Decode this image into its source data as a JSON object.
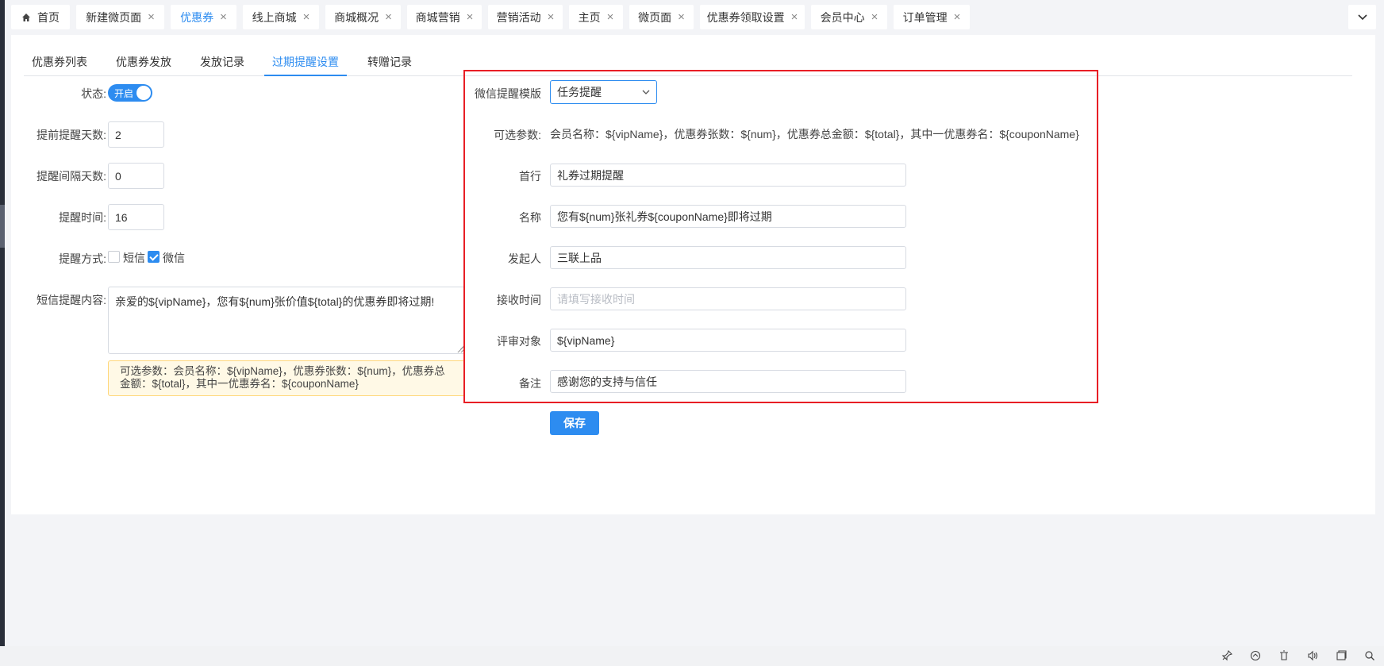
{
  "tabs": [
    {
      "label": "首页",
      "closable": false,
      "active": false
    },
    {
      "label": "新建微页面",
      "closable": true,
      "active": false
    },
    {
      "label": "优惠券",
      "closable": true,
      "active": true
    },
    {
      "label": "线上商城",
      "closable": true,
      "active": false
    },
    {
      "label": "商城概况",
      "closable": true,
      "active": false
    },
    {
      "label": "商城营销",
      "closable": true,
      "active": false
    },
    {
      "label": "营销活动",
      "closable": true,
      "active": false
    },
    {
      "label": "主页",
      "closable": true,
      "active": false
    },
    {
      "label": "微页面",
      "closable": true,
      "active": false
    },
    {
      "label": "优惠券领取设置",
      "closable": true,
      "active": false
    },
    {
      "label": "会员中心",
      "closable": true,
      "active": false
    },
    {
      "label": "订单管理",
      "closable": true,
      "active": false
    }
  ],
  "subtabs": [
    "优惠券列表",
    "优惠券发放",
    "发放记录",
    "过期提醒设置",
    "转赠记录"
  ],
  "active_subtab": "过期提醒设置",
  "form": {
    "status_label": "状态:",
    "status_text": "开启",
    "advance_days_label": "提前提醒天数:",
    "advance_days": "2",
    "interval_days_label": "提醒间隔天数:",
    "interval_days": "0",
    "time_label": "提醒时间:",
    "time": "16",
    "method_label": "提醒方式:",
    "method_sms": "短信",
    "method_sms_checked": false,
    "method_wechat": "微信",
    "method_wechat_checked": true,
    "sms_content_label": "短信提醒内容:",
    "sms_content": "亲爱的${vipName}，您有${num}张价值${total}的优惠券即将过期!",
    "sms_tip": "可选参数：会员名称：${vipName}，优惠券张数：${num}，优惠券总金额：${total}，其中一优惠券名：${couponName}"
  },
  "wechat": {
    "template_label": "微信提醒模版",
    "template_value": "任务提醒",
    "params_label": "可选参数:",
    "params_text": "会员名称：${vipName}，优惠券张数：${num}，优惠券总金额：${total}，其中一优惠券名：${couponName}",
    "first_label": "首行",
    "first_value": "礼券过期提醒",
    "name_label": "名称",
    "name_value": "您有${num}张礼券${couponName}即将过期",
    "sender_label": "发起人",
    "sender_value": "三联上品",
    "receive_label": "接收时间",
    "receive_placeholder": "请填写接收时间",
    "target_label": "评审对象",
    "target_value": "${vipName}",
    "remark_label": "备注",
    "remark_value": "感谢您的支持与信任"
  },
  "save_label": "保存",
  "colors": {
    "accent": "#2d8cf0",
    "highlight_box": "#e81e25",
    "tip_bg": "#fff9e6"
  },
  "tray_icons": [
    "pin-icon",
    "chat-icon",
    "trash-icon",
    "volume-icon",
    "window-icon",
    "search-icon"
  ]
}
